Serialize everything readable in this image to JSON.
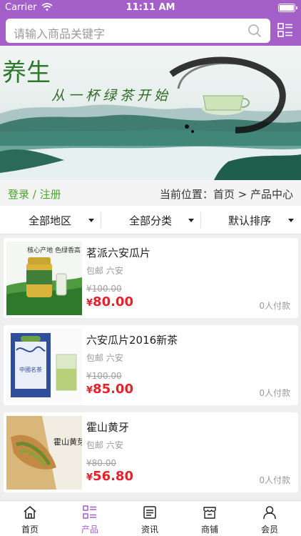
{
  "status_bar": {
    "carrier": "Carrier",
    "time": "11:11 AM"
  },
  "search": {
    "placeholder": "请输入商品关键字",
    "icon": "search-icon",
    "menu_icon": "list-icon"
  },
  "banner": {
    "title": "养生",
    "subtitle": "从一杯绿茶开始"
  },
  "user": {
    "login_label": "登录 / 注册"
  },
  "breadcrumb": {
    "text": "当前位置：首页 > 产品中心"
  },
  "filters": [
    {
      "label": "全部地区"
    },
    {
      "label": "全部分类"
    },
    {
      "label": "默认排序"
    }
  ],
  "products": [
    {
      "name": "茗派六安瓜片",
      "meta": "包邮  六安",
      "old_price": "¥100.00",
      "currency": "¥",
      "price": "80.00",
      "sold": "0人付款",
      "thumb_text": "核心产地 色绿香高"
    },
    {
      "name": "六安瓜片2016新茶",
      "meta": "包邮  六安",
      "old_price": "¥100.00",
      "currency": "¥",
      "price": "85.00",
      "sold": "0人付款",
      "thumb_text": "中國名茶"
    },
    {
      "name": "霍山黄牙",
      "meta": "包邮  六安",
      "old_price": "¥80.00",
      "currency": "¥",
      "price": "56.80",
      "sold": "0人付款",
      "thumb_text": "霍山黄芽"
    }
  ],
  "tabbar": [
    {
      "label": "首页",
      "icon": "home-icon"
    },
    {
      "label": "产品",
      "icon": "product-list-icon",
      "active": true
    },
    {
      "label": "资讯",
      "icon": "news-icon"
    },
    {
      "label": "商铺",
      "icon": "shop-icon"
    },
    {
      "label": "会员",
      "icon": "member-icon"
    }
  ],
  "colors": {
    "accent": "#a45fc8",
    "price": "#e4222b",
    "login": "#4aa52c"
  }
}
